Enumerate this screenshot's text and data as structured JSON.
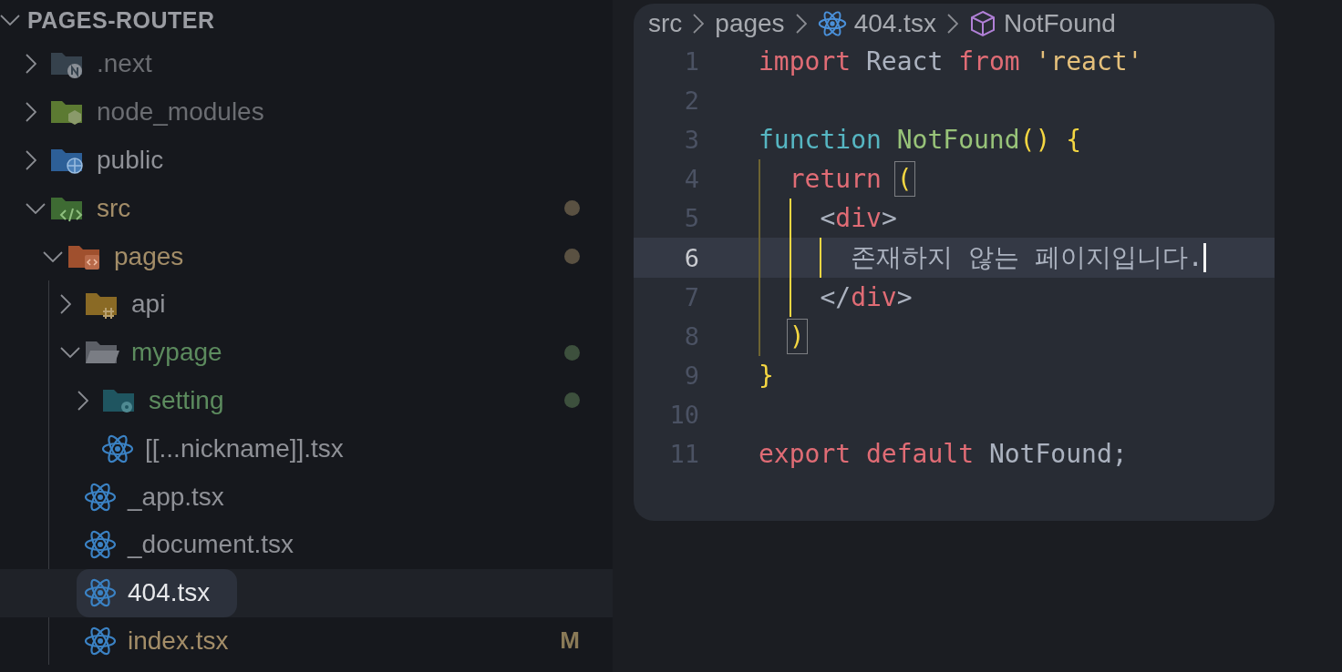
{
  "explorer": {
    "title": "PAGES-ROUTER",
    "expanded": true,
    "items": [
      {
        "name": ".next",
        "kind": "nextjs",
        "expanded": false,
        "selected": false,
        "color": "#6b6d72"
      },
      {
        "name": "node_modules",
        "kind": "node",
        "expanded": false,
        "selected": false,
        "color": "#6b6d72"
      },
      {
        "name": "public",
        "kind": "public",
        "expanded": false,
        "selected": false,
        "color": "#8f9197"
      },
      {
        "name": "src",
        "kind": "source",
        "expanded": true,
        "selected": false,
        "color": "#a38d68",
        "dot": true,
        "children": [
          {
            "name": "pages",
            "kind": "pages",
            "expanded": true,
            "selected": false,
            "color": "#a38d68",
            "dot": true,
            "children": [
              {
                "name": "api",
                "kind": "api",
                "expanded": false,
                "selected": false,
                "color": "#8f9197"
              },
              {
                "name": "mypage",
                "kind": "folder",
                "expanded": true,
                "selected": false,
                "color": "#5c8b5e",
                "dot": true,
                "children": [
                  {
                    "name": "setting",
                    "kind": "setting",
                    "expanded": false,
                    "selected": false,
                    "color": "#5c8b5e",
                    "dot": true
                  },
                  {
                    "name": "[[...nickname]].tsx",
                    "kind": "react",
                    "selected": false,
                    "color": "#8f9197"
                  }
                ]
              },
              {
                "name": "_app.tsx",
                "kind": "react",
                "selected": false,
                "color": "#8f9197"
              },
              {
                "name": "_document.tsx",
                "kind": "react",
                "selected": false,
                "color": "#8f9197"
              },
              {
                "name": "404.tsx",
                "kind": "react",
                "selected": true,
                "color": "#e6e7ea"
              },
              {
                "name": "index.tsx",
                "kind": "react",
                "selected": false,
                "color": "#a38d68",
                "badge": "M"
              }
            ]
          }
        ]
      }
    ]
  },
  "editor": {
    "breadcrumb": [
      {
        "label": "src",
        "kind": "text"
      },
      {
        "label": "pages",
        "kind": "text"
      },
      {
        "label": "404.tsx",
        "kind": "react"
      },
      {
        "label": "NotFound",
        "kind": "symbol"
      }
    ],
    "lines": [
      {
        "number": "1",
        "selected": false,
        "tokens": [
          {
            "kind": "keyword",
            "text": "import "
          },
          {
            "kind": "plain",
            "text": "React "
          },
          {
            "kind": "keyword",
            "text": "from "
          },
          {
            "kind": "string",
            "text": "'react'"
          }
        ]
      },
      {
        "number": "2",
        "selected": false
      },
      {
        "number": "3",
        "selected": false,
        "tokens": [
          {
            "kind": "storage",
            "text": "function "
          },
          {
            "kind": "function",
            "text": "NotFound"
          },
          {
            "kind": "bracket",
            "text": "() {"
          }
        ]
      },
      {
        "number": "4",
        "selected": false,
        "tokens": [
          {
            "kind": "keyword",
            "text": "  return "
          },
          {
            "kind": "bracket",
            "text": "(",
            "matched": true
          }
        ]
      },
      {
        "number": "5",
        "selected": false,
        "tokens": [
          {
            "kind": "punct",
            "text": "    <"
          },
          {
            "kind": "tag",
            "text": "div"
          },
          {
            "kind": "punct",
            "text": ">"
          }
        ]
      },
      {
        "number": "6",
        "selected": true,
        "tokens": [
          {
            "kind": "plain",
            "text": "      존재하지 않는 페이지입니다."
          }
        ]
      },
      {
        "number": "7",
        "selected": false,
        "tokens": [
          {
            "kind": "punct",
            "text": "    </"
          },
          {
            "kind": "tag",
            "text": "div"
          },
          {
            "kind": "punct",
            "text": ">"
          }
        ]
      },
      {
        "number": "8",
        "selected": false,
        "tokens": [
          {
            "kind": "bracket",
            "text": "  )",
            "matched": true
          }
        ]
      },
      {
        "number": "9",
        "selected": false,
        "tokens": [
          {
            "kind": "bracket",
            "text": "}"
          }
        ]
      },
      {
        "number": "10",
        "selected": false
      },
      {
        "number": "11",
        "selected": false,
        "tokens": [
          {
            "kind": "keyword",
            "text": "export default "
          },
          {
            "kind": "plain",
            "text": "NotFound;"
          }
        ]
      }
    ]
  }
}
